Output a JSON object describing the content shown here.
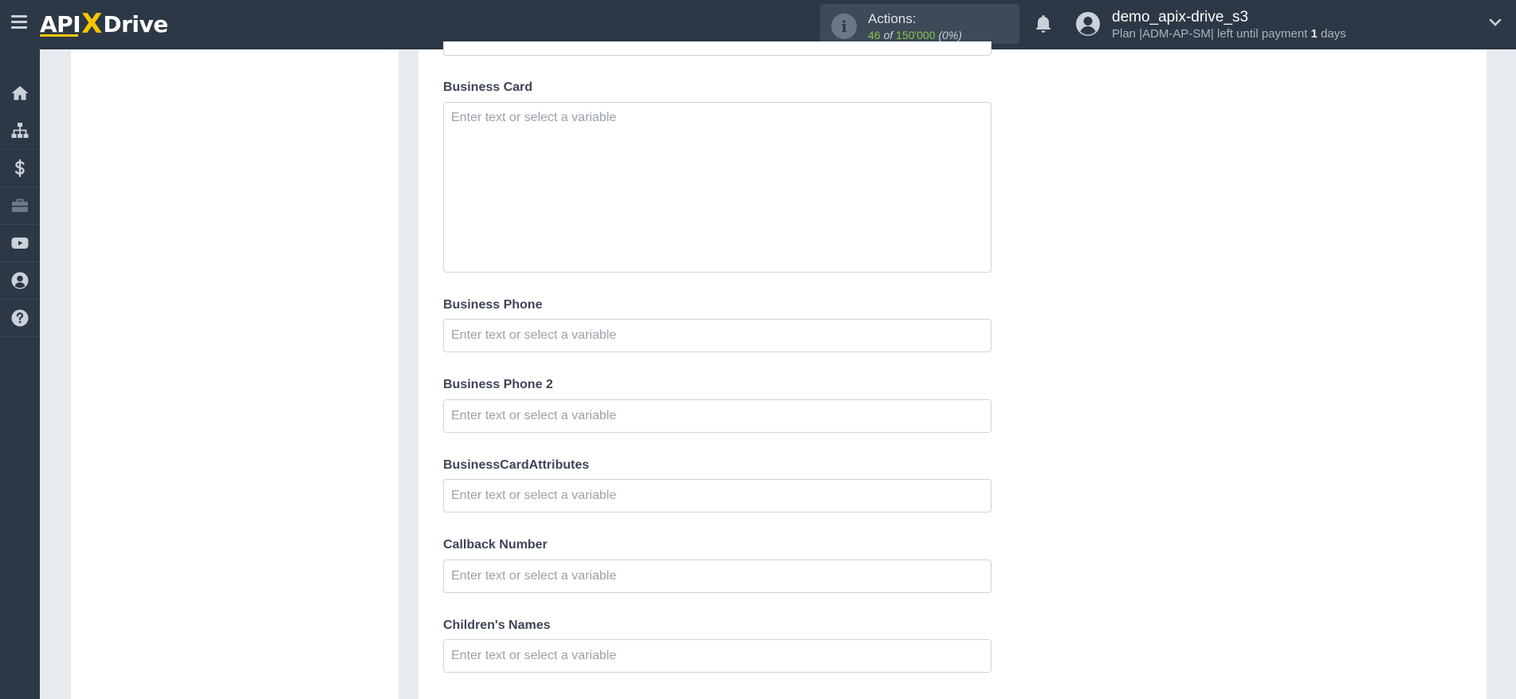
{
  "header": {
    "logo_left": "API",
    "logo_x": "X",
    "logo_right": "Drive",
    "actions_label": "Actions:",
    "actions_used": "46",
    "actions_of": "of",
    "actions_total": "150'000",
    "actions_percent": "(0%)",
    "user_name": "demo_apix-drive_s3",
    "plan_prefix": "Plan |ADM-AP-SM| left until payment",
    "plan_days_num": "1",
    "plan_days_word": "days"
  },
  "sidebar": {
    "items": [
      {
        "icon": "home-icon"
      },
      {
        "icon": "sitemap-icon"
      },
      {
        "icon": "dollar-icon"
      },
      {
        "icon": "briefcase-icon"
      },
      {
        "icon": "youtube-icon"
      },
      {
        "icon": "user-circle-icon"
      },
      {
        "icon": "question-circle-icon"
      }
    ]
  },
  "form": {
    "fields": [
      {
        "label": "Business Card",
        "placeholder": "Enter text or select a variable"
      },
      {
        "label": "Business Phone",
        "placeholder": "Enter text or select a variable"
      },
      {
        "label": "Business Phone 2",
        "placeholder": "Enter text or select a variable"
      },
      {
        "label": "BusinessCardAttributes",
        "placeholder": "Enter text or select a variable"
      },
      {
        "label": "Callback Number",
        "placeholder": "Enter text or select a variable"
      },
      {
        "label": "Children's Names",
        "placeholder": "Enter text or select a variable"
      }
    ]
  },
  "colors": {
    "topbar": "#2c3845",
    "accent_yellow": "#f7c600",
    "actions_green": "#8bc34a",
    "background": "#e7ebef"
  }
}
